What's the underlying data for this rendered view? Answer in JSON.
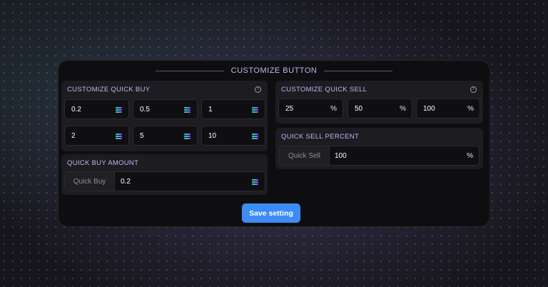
{
  "panel": {
    "title": "CUSTOMIZE BUTTON"
  },
  "quick_buy": {
    "title": "CUSTOMIZE QUICK BUY",
    "values": [
      "0.2",
      "0.5",
      "1",
      "2",
      "5",
      "10"
    ],
    "currency_icon": "solana-icon"
  },
  "quick_sell": {
    "title": "CUSTOMIZE QUICK SELL",
    "values": [
      "25",
      "50",
      "100"
    ],
    "unit": "%"
  },
  "quick_buy_amount": {
    "title": "QUICK BUY AMOUNT",
    "prefix": "Quick Buy",
    "value": "0.2"
  },
  "quick_sell_percent": {
    "title": "QUICK SELL PERCENT",
    "prefix": "Quick Sell",
    "value": "100",
    "unit": "%"
  },
  "help_icon": "?",
  "save_button": {
    "label": "Save setting"
  },
  "colors": {
    "accent": "#3d8cf5",
    "heading": "#b7bcf0",
    "panel_bg": "#0e0e10",
    "card_bg": "#1c1c21"
  }
}
